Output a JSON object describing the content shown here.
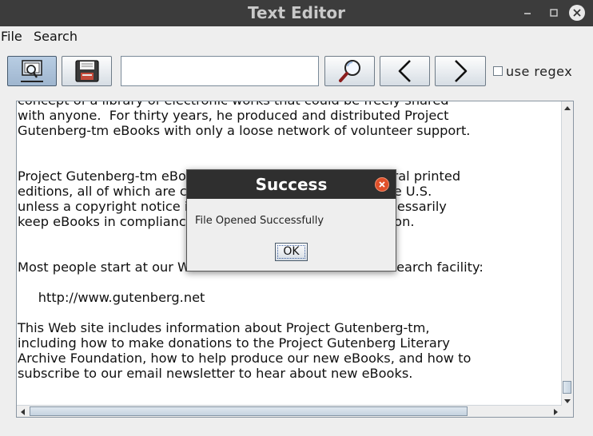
{
  "window": {
    "title": "Text Editor"
  },
  "menubar": {
    "items": [
      {
        "label": "File"
      },
      {
        "label": "Search"
      }
    ]
  },
  "toolbar": {
    "search_value": "",
    "regex_label": "use regex",
    "regex_checked": false
  },
  "editor": {
    "lines": [
      "concept of a library of electronic works that could be freely shared",
      "with anyone.  For thirty years, he produced and distributed Project",
      "Gutenberg-tm eBooks with only a loose network of volunteer support.",
      "",
      "",
      "Project Gutenberg-tm eBooks are often created from several printed",
      "editions, all of which are confirmed as Public Domain in the U.S.",
      "unless a copyright notice is included.  Thus, we do not necessarily",
      "keep eBooks in compliance with any particular paper edition.",
      "",
      "",
      "Most people start at our Web site which has the main PG search facility:",
      "",
      "     http://www.gutenberg.net",
      "",
      "This Web site includes information about Project Gutenberg-tm,",
      "including how to make donations to the Project Gutenberg Literary",
      "Archive Foundation, how to help produce our new eBooks, and how to",
      "subscribe to our email newsletter to hear about new eBooks."
    ]
  },
  "dialog": {
    "title": "Success",
    "message": "File Opened Successfully",
    "ok_label": "OK"
  }
}
